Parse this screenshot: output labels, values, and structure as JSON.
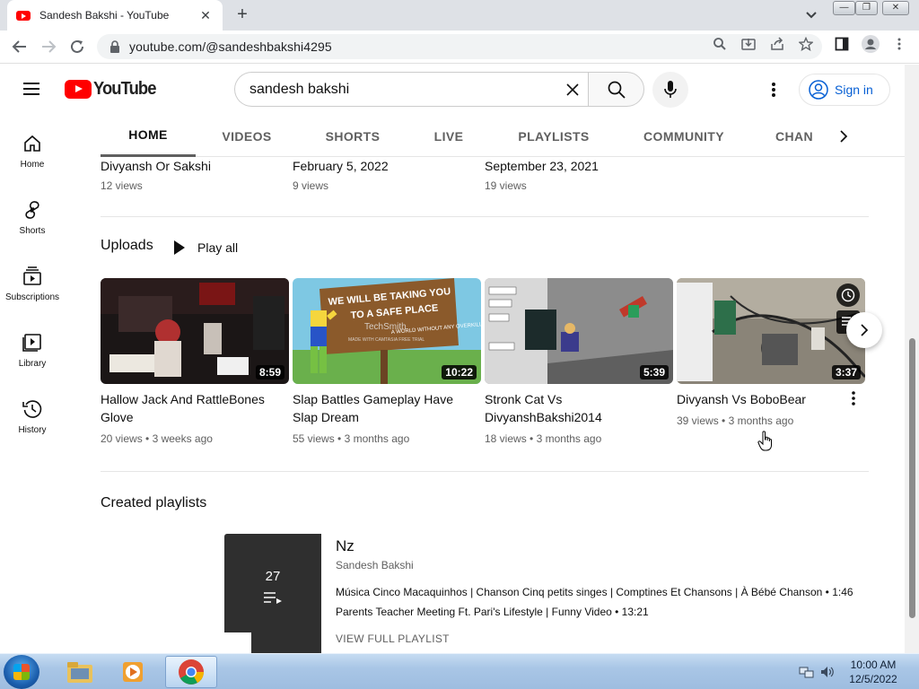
{
  "browser": {
    "tab_title": "Sandesh Bakshi - YouTube",
    "url": "youtube.com/@sandeshbakshi4295"
  },
  "header": {
    "logo_text": "YouTube",
    "search_query": "sandesh bakshi",
    "signin_label": "Sign in"
  },
  "guide": {
    "items": [
      {
        "label": "Home",
        "icon": "home-icon"
      },
      {
        "label": "Shorts",
        "icon": "shorts-icon"
      },
      {
        "label": "Subscriptions",
        "icon": "subscriptions-icon"
      },
      {
        "label": "Library",
        "icon": "library-icon"
      },
      {
        "label": "History",
        "icon": "history-icon"
      }
    ]
  },
  "channel_tabs": [
    "HOME",
    "VIDEOS",
    "SHORTS",
    "LIVE",
    "PLAYLISTS",
    "COMMUNITY",
    "CHAN"
  ],
  "previous_row": [
    {
      "title": "Divyansh Or Sakshi",
      "meta": "12 views"
    },
    {
      "title": "February 5, 2022",
      "meta": "9 views"
    },
    {
      "title": "September 23, 2021",
      "meta": "19 views"
    }
  ],
  "uploads": {
    "title": "Uploads",
    "play_all": "Play all",
    "videos": [
      {
        "title": "Hallow Jack And RattleBones Glove",
        "duration": "8:59",
        "views": "20 views",
        "age": "3 weeks ago"
      },
      {
        "title": "Slap Battles Gameplay Have Slap Dream",
        "duration": "10:22",
        "views": "55 views",
        "age": "3 months ago"
      },
      {
        "title": "Stronk Cat Vs DivyanshBakshi2014",
        "duration": "5:39",
        "views": "18 views",
        "age": "3 months ago"
      },
      {
        "title": "Divyansh Vs BoboBear",
        "duration": "3:37",
        "views": "39 views",
        "age": "3 months ago"
      }
    ]
  },
  "thumb_text": {
    "sign_line1": "WE WILL BE TAKING YOU",
    "sign_line2": "TO A SAFE PLACE",
    "sign_line3": "A WORLD WITHOUT ANY OVERKILLS",
    "watermark": "TechSmith",
    "watermark_sub": "MADE WITH CAMTASIA FREE TRIAL"
  },
  "playlists": {
    "title": "Created playlists",
    "name": "Nz",
    "owner": "Sandesh Bakshi",
    "count": "27",
    "videos": [
      {
        "title": "Música Cinco Macaquinhos | Chanson Cinq petits singes | Comptines Et Chansons | À Bébé Chanson",
        "duration": "1:46"
      },
      {
        "title": "Parents Teacher Meeting Ft. Pari's Lifestyle | Funny Video",
        "duration": "13:21"
      }
    ],
    "view_full": "VIEW FULL PLAYLIST"
  },
  "taskbar": {
    "time": "10:00 AM",
    "date": "12/5/2022"
  },
  "colors": {
    "yt_red": "#ff0000",
    "link_blue": "#065fd4",
    "meta_gray": "#606060"
  }
}
